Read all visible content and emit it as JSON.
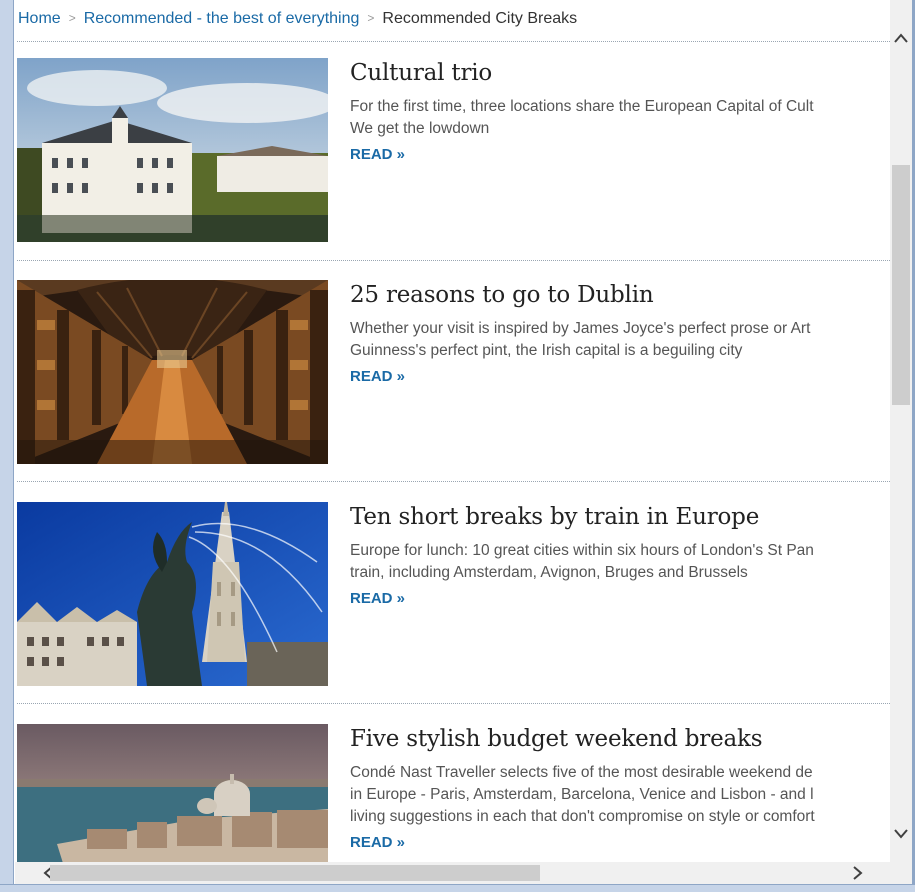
{
  "breadcrumb": {
    "home": "Home",
    "section": "Recommended - the best of everything",
    "current": "Recommended City Breaks",
    "separator": ">"
  },
  "articles": [
    {
      "title": "Cultural trio",
      "description": "For the first time, three locations share the European Capital of Cult\nWe get the lowdown",
      "read_label": "READ »",
      "image": "castle-photo"
    },
    {
      "title": "25 reasons to go to Dublin",
      "description": "Whether your visit is inspired by James Joyce's perfect prose or Art\nGuinness's perfect pint, the Irish capital is a beguiling city",
      "read_label": "READ »",
      "image": "library-photo"
    },
    {
      "title": "Ten short breaks by train in Europe",
      "description": "Europe for lunch: 10 great cities within six hours of London's St Pan\ntrain, including Amsterdam, Avignon, Bruges and Brussels",
      "read_label": "READ »",
      "image": "fountain-photo"
    },
    {
      "title": "Five stylish budget weekend breaks",
      "description": "Condé Nast Traveller selects five of the most desirable weekend de\nin Europe - Paris, Amsterdam, Barcelona, Venice and Lisbon - and l\nliving suggestions in each that don't compromise on style or comfort",
      "read_label": "READ »",
      "image": "venice-photo"
    }
  ],
  "scrollbar": {
    "up_icon": "chevron-up-icon",
    "down_icon": "chevron-down-icon",
    "left_icon": "chevron-left-icon",
    "right_icon": "chevron-right-icon"
  },
  "colors": {
    "link": "#1a6aa6",
    "title": "#222222",
    "body_text": "#555555",
    "frame": "#c6d4e8"
  }
}
